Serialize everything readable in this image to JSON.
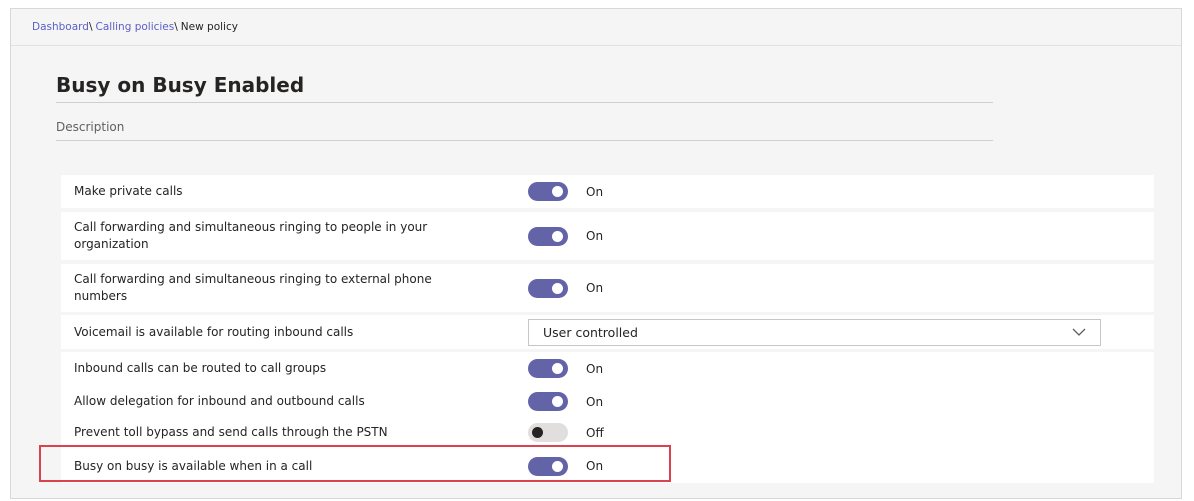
{
  "breadcrumb": {
    "items": [
      "Dashboard",
      "Calling policies",
      "New policy"
    ],
    "separator": "\\"
  },
  "policy": {
    "title": "Busy on Busy Enabled",
    "description_placeholder": "Description"
  },
  "settings": [
    {
      "label": "Make private calls",
      "control": "toggle",
      "state": "on",
      "state_label": "On"
    },
    {
      "label": "Call forwarding and simultaneous ringing to people in your organization",
      "control": "toggle",
      "state": "on",
      "state_label": "On"
    },
    {
      "label": "Call forwarding and simultaneous ringing to external phone numbers",
      "control": "toggle",
      "state": "on",
      "state_label": "On"
    },
    {
      "label": "Voicemail is available for routing inbound calls",
      "control": "dropdown",
      "value": "User controlled"
    },
    {
      "label": "Inbound calls can be routed to call groups",
      "control": "toggle",
      "state": "on",
      "state_label": "On"
    },
    {
      "label": "Allow delegation for inbound and outbound calls",
      "control": "toggle",
      "state": "on",
      "state_label": "On"
    },
    {
      "label": "Prevent toll bypass and send calls through the PSTN",
      "control": "toggle",
      "state": "off",
      "state_label": "Off"
    },
    {
      "label": "Busy on busy is available when in a call",
      "control": "toggle",
      "state": "on",
      "state_label": "On",
      "highlighted": true
    }
  ],
  "colors": {
    "accent": "#6264a7",
    "link": "#5b5fc7",
    "highlight_border": "#d9434e",
    "toggle_off_track": "#e1dfdd"
  },
  "icons": {
    "dropdown": "chevron-down-icon"
  }
}
